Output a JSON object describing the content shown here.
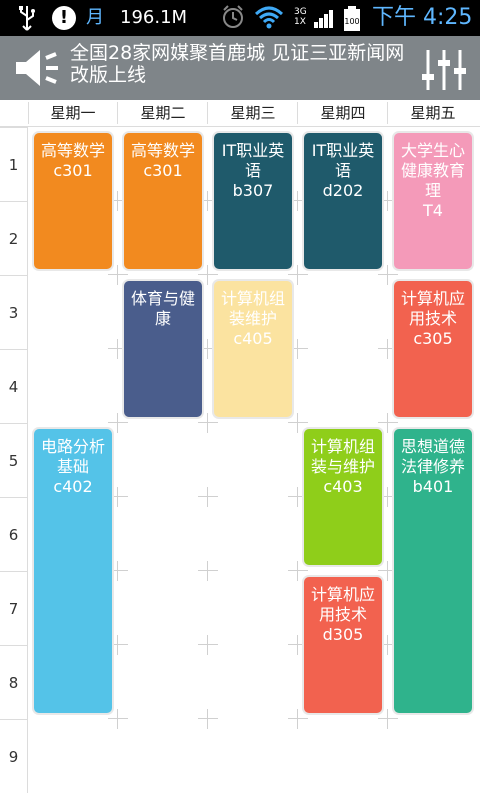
{
  "status_bar": {
    "usb_icon": "usb-icon",
    "alert_icon": "alert-icon",
    "alert_symbol": "!",
    "calendar_text": "月",
    "data_usage": "196.1M",
    "network_label": "3G\n1X",
    "battery_level": "100",
    "time": "下午 4:25"
  },
  "header": {
    "speaker_icon": "speaker-icon",
    "headline": "全国28家网媒聚首鹿城 见证三亚新闻网改版上线",
    "settings_icon": "equalizer-icon"
  },
  "days": [
    "星期一",
    "星期二",
    "星期三",
    "星期四",
    "星期五"
  ],
  "periods": [
    "1",
    "2",
    "3",
    "4",
    "5",
    "6",
    "7",
    "8",
    "9"
  ],
  "courses": [
    {
      "name": "高等数学",
      "room": "c301",
      "day": 1,
      "start": 1,
      "end": 2,
      "color": "#f28a1f"
    },
    {
      "name": "高等数学",
      "room": "c301",
      "day": 2,
      "start": 1,
      "end": 2,
      "color": "#f28a1f"
    },
    {
      "name": "IT职业英语",
      "room": "b307",
      "day": 3,
      "start": 1,
      "end": 2,
      "color": "#1f5a6b"
    },
    {
      "name": "IT职业英语",
      "room": "d202",
      "day": 4,
      "start": 1,
      "end": 2,
      "color": "#1f5a6b"
    },
    {
      "name": "大学生心健康教育理",
      "room": "T4",
      "day": 5,
      "start": 1,
      "end": 2,
      "color": "#f49ab9"
    },
    {
      "name": "体育与健康",
      "room": "",
      "day": 2,
      "start": 3,
      "end": 4,
      "color": "#4a5d8c"
    },
    {
      "name": "计算机组装维护",
      "room": "c405",
      "day": 3,
      "start": 3,
      "end": 4,
      "color": "#fbe3a0"
    },
    {
      "name": "计算机应用技术",
      "room": "c305",
      "day": 5,
      "start": 3,
      "end": 4,
      "color": "#f2624f"
    },
    {
      "name": "电路分析基础",
      "room": "c402",
      "day": 1,
      "start": 5,
      "end": 8,
      "color": "#54c3e8"
    },
    {
      "name": "计算机组装与维护",
      "room": "c403",
      "day": 4,
      "start": 5,
      "end": 6,
      "color": "#8fce1a"
    },
    {
      "name": "思想道德法律修养",
      "room": "b401",
      "day": 5,
      "start": 5,
      "end": 8,
      "color": "#2fb38c"
    },
    {
      "name": "计算机应用技术",
      "room": "d305",
      "day": 4,
      "start": 7,
      "end": 8,
      "color": "#f2624f"
    }
  ]
}
